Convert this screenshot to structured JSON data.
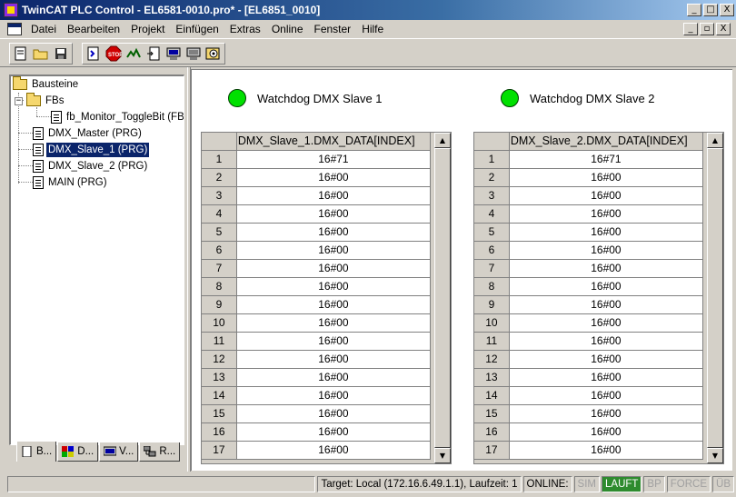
{
  "window": {
    "title": "TwinCAT PLC Control - EL6581-0010.pro* - [EL6851_0010]",
    "caption_buttons": [
      "_",
      "□",
      "X"
    ],
    "mdi_buttons": [
      "_",
      "▫",
      "X"
    ]
  },
  "menu": [
    "Datei",
    "Bearbeiten",
    "Projekt",
    "Einfügen",
    "Extras",
    "Online",
    "Fenster",
    "Hilfe"
  ],
  "toolbar": {
    "buttons": [
      "new-icon",
      "open-icon",
      "save-icon",
      "compile-icon",
      "stop-icon",
      "run-icon",
      "step-icon",
      "login-icon",
      "logout-icon",
      "watch-icon"
    ]
  },
  "tree": {
    "root": "Bausteine",
    "fbs_folder": "FBs",
    "fb_item": "fb_Monitor_ToggleBit (FB)",
    "items": [
      "DMX_Master (PRG)",
      "DMX_Slave_1 (PRG)",
      "DMX_Slave_2 (PRG)",
      "MAIN (PRG)"
    ],
    "selected": "DMX_Slave_1 (PRG)"
  },
  "tabs": [
    "B...",
    "D...",
    "V...",
    "R..."
  ],
  "colors": {
    "lamp_on": "#00e000",
    "selection": "#0a246a",
    "running": "#2e8b2e"
  },
  "visualization": {
    "watchdog1": "Watchdog DMX Slave 1",
    "watchdog2": "Watchdog DMX Slave 2",
    "table1": {
      "header": "DMX_Slave_1.DMX_DATA[INDEX]",
      "rows": [
        {
          "i": "1",
          "v": "16#71"
        },
        {
          "i": "2",
          "v": "16#00"
        },
        {
          "i": "3",
          "v": "16#00"
        },
        {
          "i": "4",
          "v": "16#00"
        },
        {
          "i": "5",
          "v": "16#00"
        },
        {
          "i": "6",
          "v": "16#00"
        },
        {
          "i": "7",
          "v": "16#00"
        },
        {
          "i": "8",
          "v": "16#00"
        },
        {
          "i": "9",
          "v": "16#00"
        },
        {
          "i": "10",
          "v": "16#00"
        },
        {
          "i": "11",
          "v": "16#00"
        },
        {
          "i": "12",
          "v": "16#00"
        },
        {
          "i": "13",
          "v": "16#00"
        },
        {
          "i": "14",
          "v": "16#00"
        },
        {
          "i": "15",
          "v": "16#00"
        },
        {
          "i": "16",
          "v": "16#00"
        },
        {
          "i": "17",
          "v": "16#00"
        }
      ]
    },
    "table2": {
      "header": "DMX_Slave_2.DMX_DATA[INDEX]",
      "rows": [
        {
          "i": "1",
          "v": "16#71"
        },
        {
          "i": "2",
          "v": "16#00"
        },
        {
          "i": "3",
          "v": "16#00"
        },
        {
          "i": "4",
          "v": "16#00"
        },
        {
          "i": "5",
          "v": "16#00"
        },
        {
          "i": "6",
          "v": "16#00"
        },
        {
          "i": "7",
          "v": "16#00"
        },
        {
          "i": "8",
          "v": "16#00"
        },
        {
          "i": "9",
          "v": "16#00"
        },
        {
          "i": "10",
          "v": "16#00"
        },
        {
          "i": "11",
          "v": "16#00"
        },
        {
          "i": "12",
          "v": "16#00"
        },
        {
          "i": "13",
          "v": "16#00"
        },
        {
          "i": "14",
          "v": "16#00"
        },
        {
          "i": "15",
          "v": "16#00"
        },
        {
          "i": "16",
          "v": "16#00"
        },
        {
          "i": "17",
          "v": "16#00"
        }
      ]
    }
  },
  "status": {
    "target": "Target: Local (172.16.6.49.1.1), Laufzeit: 1",
    "online": "ONLINE:",
    "sim": "SIM",
    "laeuft": "LAUFT",
    "bp": "BP",
    "force": "FORCE",
    "ueb": "ÜB"
  }
}
